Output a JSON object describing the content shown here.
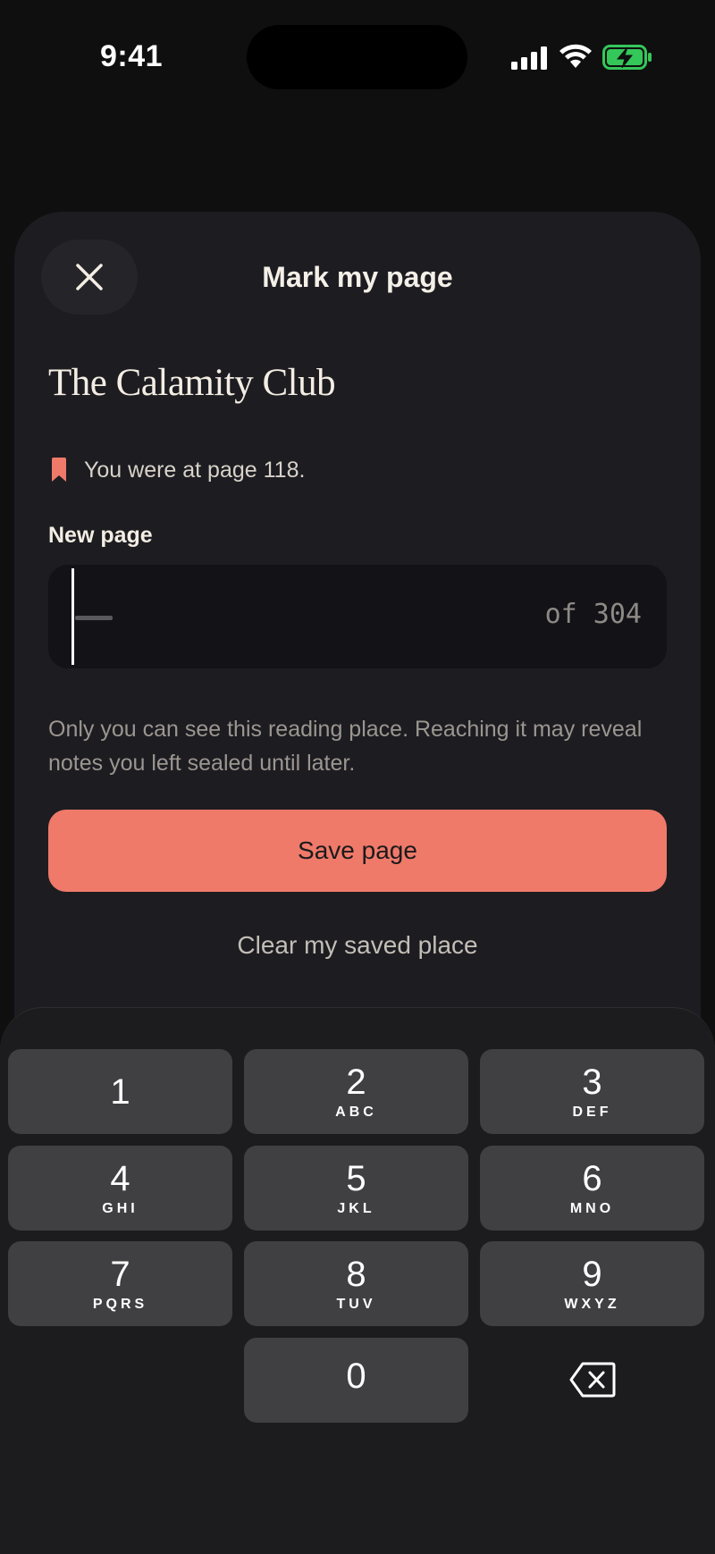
{
  "status_bar": {
    "time": "9:41"
  },
  "sheet": {
    "title": "Mark my page"
  },
  "book": {
    "title": "The Calamity Club"
  },
  "last_page": {
    "text": "You were at page 118."
  },
  "new_page": {
    "label": "New page",
    "value": "",
    "total_text": "of 304"
  },
  "helper_text": "Only you can see this reading place. Reaching it may reveal notes you left sealed until later.",
  "actions": {
    "save_label": "Save page",
    "clear_label": "Clear my saved place"
  },
  "keyboard": {
    "keys": [
      {
        "digit": "1",
        "letters": ""
      },
      {
        "digit": "2",
        "letters": "ABC"
      },
      {
        "digit": "3",
        "letters": "DEF"
      },
      {
        "digit": "4",
        "letters": "GHI"
      },
      {
        "digit": "5",
        "letters": "JKL"
      },
      {
        "digit": "6",
        "letters": "MNO"
      },
      {
        "digit": "7",
        "letters": "PQRS"
      },
      {
        "digit": "8",
        "letters": "TUV"
      },
      {
        "digit": "9",
        "letters": "WXYZ"
      },
      {
        "digit": "0",
        "letters": ""
      }
    ]
  },
  "colors": {
    "accent": "#ef7a6a",
    "sheet_bg": "#1d1c21",
    "battery_green": "#34c759"
  },
  "icons": {
    "close": "close-icon",
    "bookmark": "bookmark-icon",
    "delete": "backspace-icon"
  }
}
